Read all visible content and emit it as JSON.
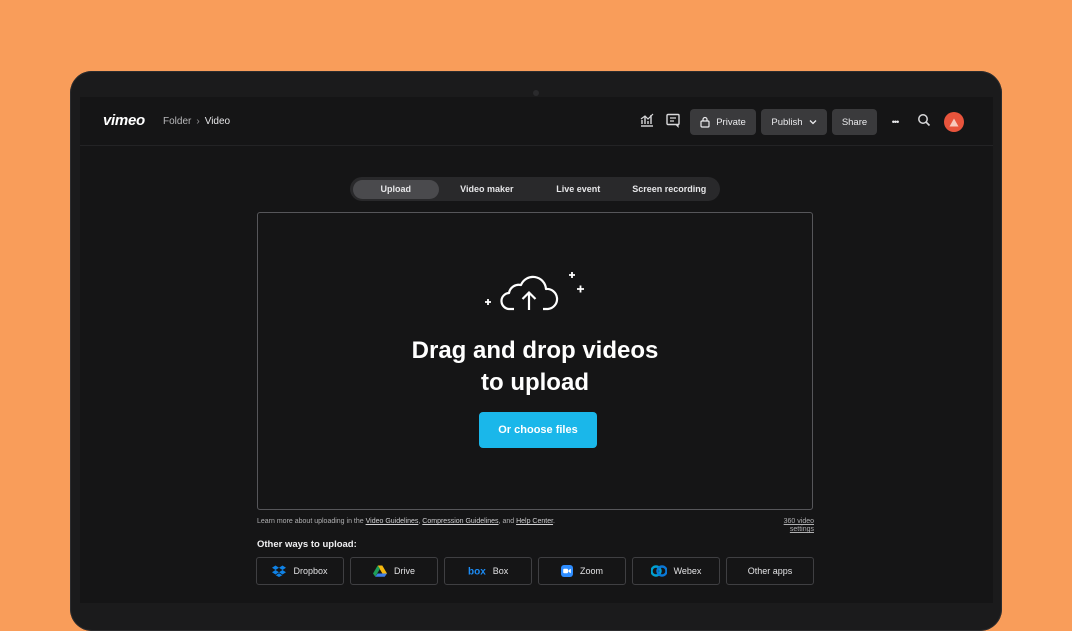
{
  "app": {
    "logo": "vimeo"
  },
  "breadcrumb": {
    "parent": "Folder",
    "separator": "›",
    "current": "Video"
  },
  "toolbar": {
    "private_label": "Private",
    "publish_label": "Publish",
    "share_label": "Share",
    "more_label": "•••"
  },
  "tabs": [
    {
      "label": "Upload",
      "active": true
    },
    {
      "label": "Video maker",
      "active": false
    },
    {
      "label": "Live event",
      "active": false
    },
    {
      "label": "Screen recording",
      "active": false
    }
  ],
  "dropzone": {
    "headline_line1": "Drag and drop videos",
    "headline_line2": "to upload",
    "choose_label": "Or choose files"
  },
  "footer_note": {
    "prefix": "Learn more about uploading in the ",
    "link1": "Video Guidelines",
    "comma": ", ",
    "link2": "Compression Guidelines",
    "and": ", and ",
    "link3": "Help Center",
    "suffix": ".",
    "settings_link": "360 video settings"
  },
  "other_ways": {
    "title": "Other ways to upload:",
    "sources": [
      {
        "label": "Dropbox",
        "icon": "dropbox-icon"
      },
      {
        "label": "Drive",
        "icon": "google-drive-icon"
      },
      {
        "label": "Box",
        "icon": "box-icon"
      },
      {
        "label": "Zoom",
        "icon": "zoom-icon"
      },
      {
        "label": "Webex",
        "icon": "webex-icon"
      },
      {
        "label": "Other apps",
        "icon": ""
      }
    ]
  },
  "colors": {
    "background": "#F99D5A",
    "screen": "#151516",
    "accent_button": "#1ab7ea",
    "avatar": "#e8543c"
  }
}
